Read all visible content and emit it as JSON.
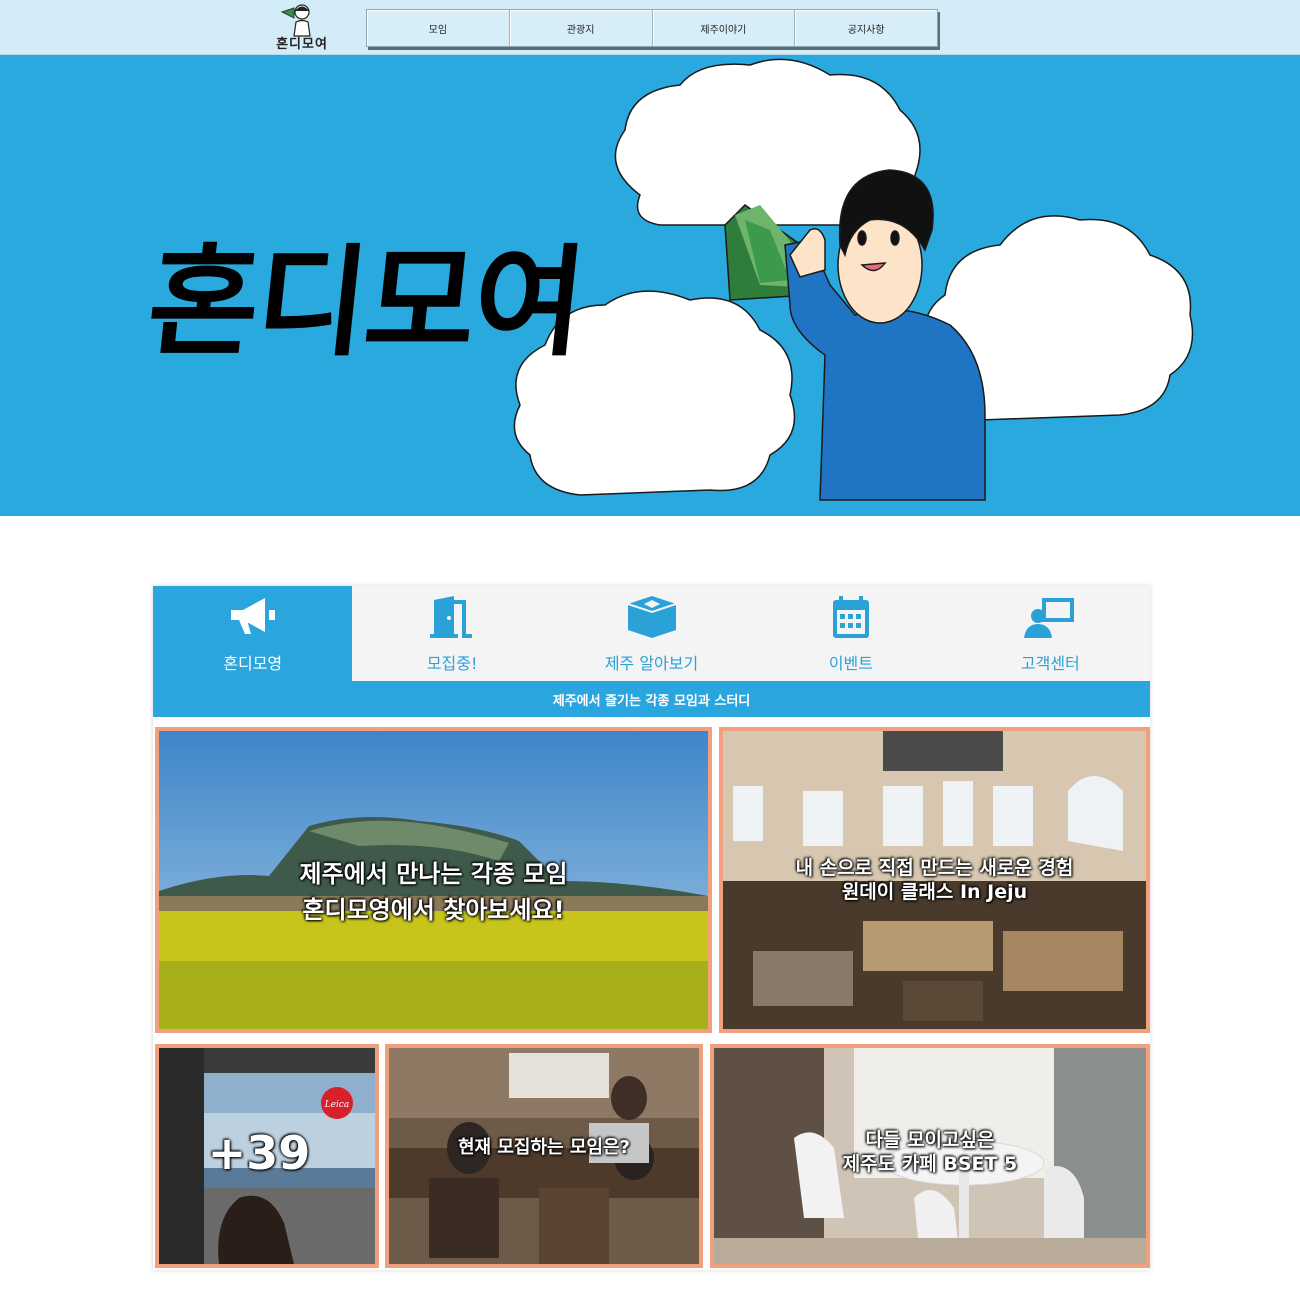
{
  "header": {
    "logo_text": "혼디모여",
    "nav": [
      "모임",
      "관광지",
      "제주이야기",
      "공지사항"
    ]
  },
  "hero": {
    "title": "혼디모여"
  },
  "tabs": [
    {
      "label": "혼디모영",
      "icon": "megaphone-icon",
      "active": true
    },
    {
      "label": "모집중!",
      "icon": "door-icon",
      "active": false
    },
    {
      "label": "제주 알아보기",
      "icon": "box-icon",
      "active": false
    },
    {
      "label": "이벤트",
      "icon": "calendar-icon",
      "active": false
    },
    {
      "label": "고객센터",
      "icon": "support-icon",
      "active": false
    }
  ],
  "subtitle": "제주에서 즐기는 각종 모임과 스터디",
  "cards": {
    "c1": {
      "line1": "제주에서 만나는 각종 모임",
      "line2": "혼디모영에서 찾아보세요!"
    },
    "c2": {
      "line1": "내 손으로 직접 만드는 새로운 경험",
      "line2": "원데이 클래스 In Jeju"
    },
    "c3": {
      "count": "+39",
      "sign": "Leica"
    },
    "c4": {
      "line1": "현재 모집하는 모임은?"
    },
    "c5": {
      "line1": "다들 모이고싶은",
      "line2": "제주도 카페 BSET 5"
    }
  },
  "colors": {
    "accent": "#2ba5de",
    "hero_bg": "#2aa9df",
    "card_border": "#f1a07f",
    "topbar": "#d4ecf8"
  }
}
